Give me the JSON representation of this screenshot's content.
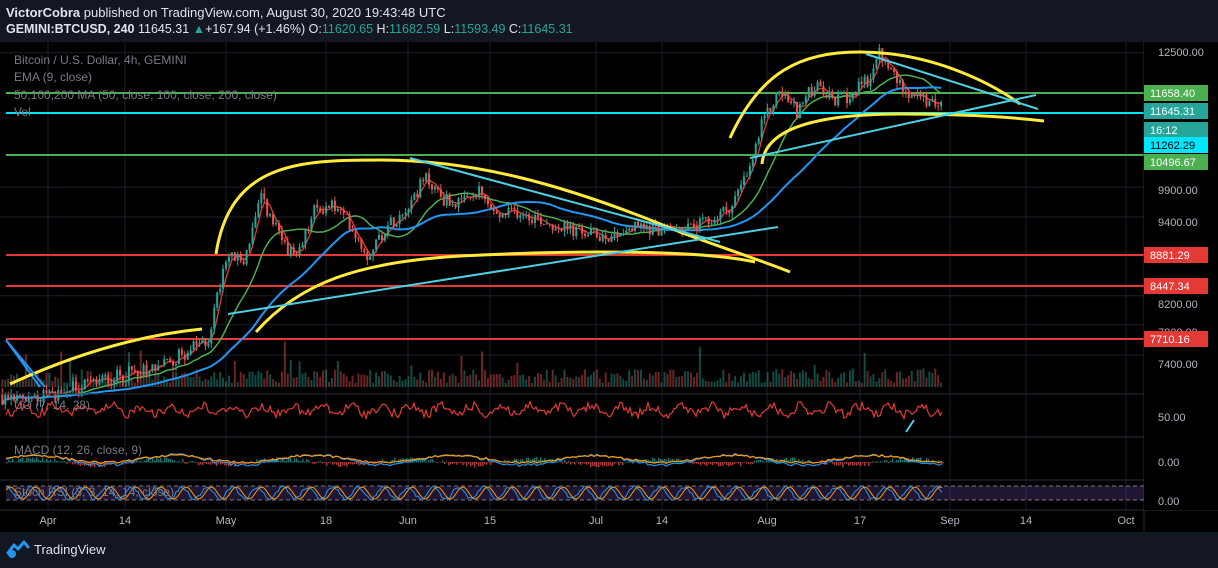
{
  "header": {
    "publisher": "VictorCobra",
    "published_text": " published on TradingView.com, August 30, 2020 19:43:48 UTC",
    "symbol": "GEMINI:BTCUSD",
    "interval": ", 240",
    "last": "11645.31",
    "change": "+167.94 (+1.46%)",
    "o_label": "O:",
    "o_val": "11620.65",
    "h_label": "H:",
    "h_val": "11682.59",
    "l_label": "L:",
    "l_val": "11593.49",
    "c_label": "C:",
    "c_val": "11645.31",
    "up_arrow": "▲"
  },
  "legend": {
    "title": "Bitcoin / U.S. Dollar, 4h, GEMINI",
    "ema": "EMA (9, close)",
    "ma": "50,100,200 MA (50, close, 100, close, 200, close)",
    "vol": "Vol",
    "uo": "UO (7, 14, 28)",
    "macd": "MACD (12, 26, close, 9)",
    "stoch": "Stoch RSI (3, 3, 14, 14, close)"
  },
  "price_scale": {
    "ticks": [
      "12500.00",
      "9900.00",
      "9400.00",
      "8200.00",
      "7800.00",
      "7400.00"
    ],
    "labels": [
      {
        "text": "11658.40",
        "color": "#4caf50"
      },
      {
        "text": "11645.31",
        "color": "#26a69a"
      },
      {
        "text": "16:12",
        "color": "#26a69a"
      },
      {
        "text": "11262.29",
        "color": "#00e5ff"
      },
      {
        "text": "10496.67",
        "color": "#4caf50"
      },
      {
        "text": "8881.29",
        "color": "#e53935"
      },
      {
        "text": "8447.34",
        "color": "#e53935"
      },
      {
        "text": "7710.16",
        "color": "#e53935"
      }
    ],
    "uo_tick": "50.00",
    "macd_tick": "0.00",
    "stoch_tick": "0.00"
  },
  "time_axis": [
    "Apr",
    "14",
    "May",
    "18",
    "Jun",
    "15",
    "Jul",
    "14",
    "Aug",
    "17",
    "Sep",
    "14",
    "Oct"
  ],
  "footer": {
    "brand": "TradingView"
  },
  "colors": {
    "bg": "#000000",
    "up": "#26a69a",
    "down": "#ef5350",
    "green_line": "#4caf50",
    "red_line": "#e53935",
    "cyan_line": "#00e5ff",
    "yellow": "#ffeb3b",
    "blue_ma": "#2196f3"
  },
  "chart_data": {
    "type": "line",
    "title": "Bitcoin / U.S. Dollar, 4h, GEMINI",
    "y_scale": "log",
    "x": [
      "Apr",
      "14",
      "May",
      "18",
      "Jun",
      "15",
      "Jul",
      "14",
      "Aug",
      "17",
      "Sep"
    ],
    "series": [
      {
        "name": "BTCUSD",
        "values": [
          7000,
          6900,
          8800,
          9500,
          9800,
          9400,
          9200,
          9200,
          11300,
          11800,
          11645
        ]
      }
    ],
    "horizontal_levels": [
      11658.4,
      11262.29,
      10496.67,
      8881.29,
      8447.34,
      7710.16
    ],
    "ylim": [
      7000,
      12600
    ]
  }
}
